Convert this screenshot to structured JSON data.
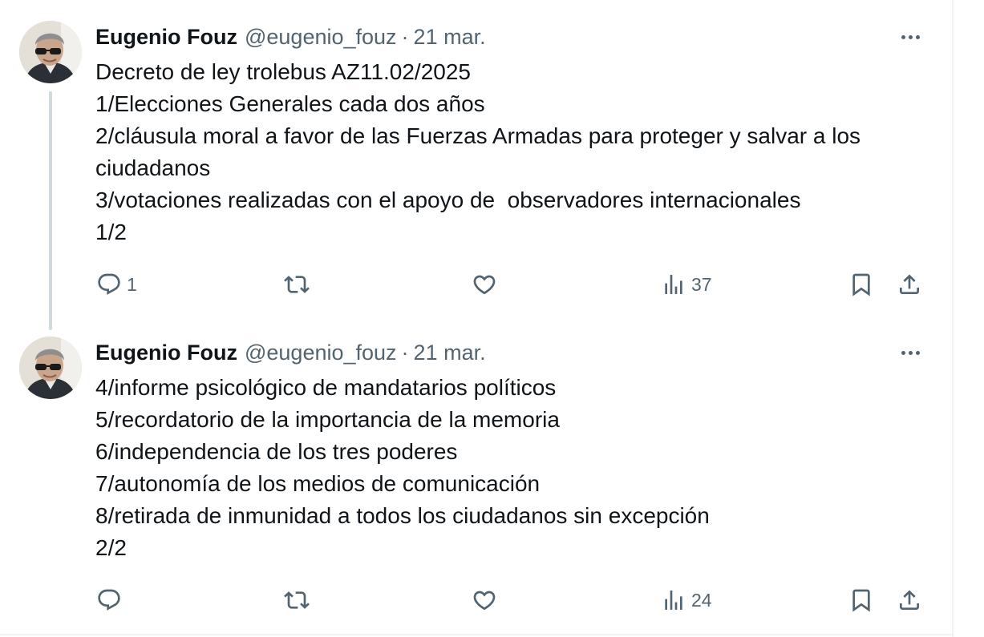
{
  "tweets": [
    {
      "author_name": "Eugenio Fouz",
      "handle": "@eugenio_fouz",
      "separator": "·",
      "date": "21 mar.",
      "lines": [
        "Decreto de ley trolebus AZ11.02/2025",
        "1/Elecciones Generales cada dos años",
        "2/cláusula moral a favor de las Fuerzas Armadas para proteger y salvar a los ciudadanos",
        "3/votaciones realizadas con el apoyo de  observadores internacionales",
        "1/2"
      ],
      "replies": "1",
      "views": "37"
    },
    {
      "author_name": "Eugenio Fouz",
      "handle": "@eugenio_fouz",
      "separator": "·",
      "date": "21 mar.",
      "lines": [
        "4/informe psicológico de mandatarios políticos",
        "5/recordatorio de la importancia de la memoria",
        "6/independencia de los tres poderes",
        "7/autonomía de los medios de comunicación",
        "8/retirada de inmunidad a todos los ciudadanos sin excepción",
        "2/2"
      ],
      "views": "24"
    }
  ],
  "icons": {
    "reply": "reply-icon",
    "retweet": "retweet-icon",
    "like": "heart-icon",
    "views": "views-icon",
    "bookmark": "bookmark-icon",
    "share": "share-icon",
    "more": "more-icon"
  },
  "colors": {
    "text": "#0f1419",
    "secondary": "#536471",
    "thread_line": "#cfd9de",
    "border": "#eff3f4"
  }
}
